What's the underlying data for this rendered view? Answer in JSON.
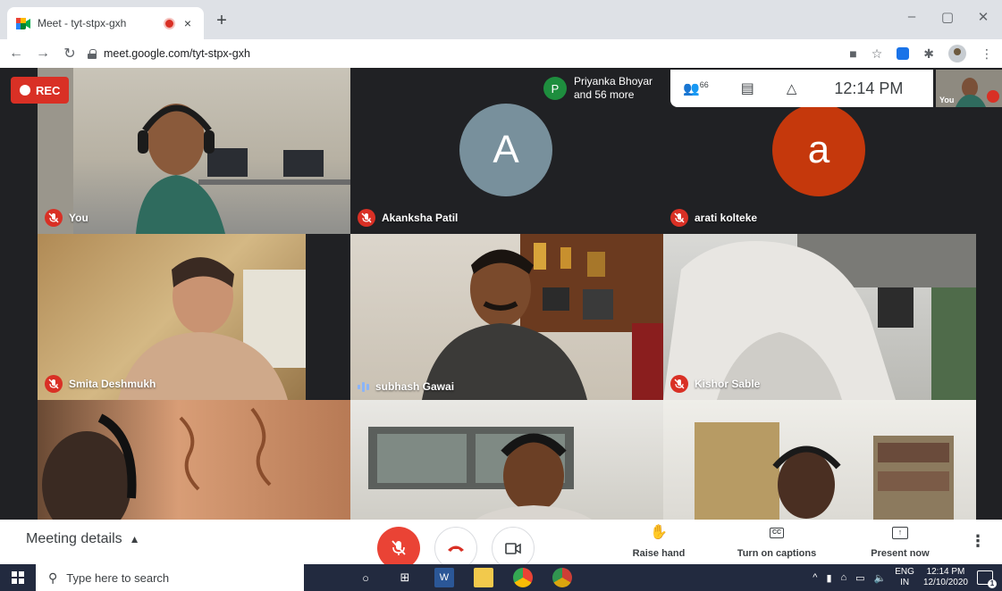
{
  "browser": {
    "tab_title": "Meet - tyt-stpx-gxh",
    "tab_close": "×",
    "new_tab": "+",
    "url": "meet.google.com/tyt-stpx-gxh",
    "win_minimize": "–",
    "win_restore": "▢",
    "win_close": "✕"
  },
  "meet": {
    "rec_label": "REC",
    "presenter_initial": "P",
    "presenter_name": "Priyanka Bhoyar",
    "presenter_more": "and 56 more",
    "people_count": "66",
    "clock": "12:14 PM",
    "self_mini_label": "You",
    "tiles": [
      {
        "name": "You",
        "status": "muted"
      },
      {
        "name": "Akanksha Patil",
        "status": "muted",
        "initial": "A"
      },
      {
        "name": "arati kolteke",
        "status": "muted",
        "initial": "a"
      },
      {
        "name": "Smita Deshmukh",
        "status": "muted"
      },
      {
        "name": "subhash Gawai",
        "status": "speaking"
      },
      {
        "name": "Kishor Sable",
        "status": "muted"
      }
    ],
    "colors": {
      "mute_red": "#d93025",
      "avatar_grey": "#78909c",
      "avatar_orange": "#c5380c",
      "presenter_green": "#1e8e3e"
    }
  },
  "meetbar": {
    "meeting_details": "Meeting details",
    "raise_hand": "Raise hand",
    "captions": "Turn on captions",
    "present": "Present now"
  },
  "taskbar": {
    "search_placeholder": "Type here to search",
    "lang_top": "ENG",
    "lang_bottom": "IN",
    "time": "12:14 PM",
    "date": "12/10/2020",
    "notif_count": "1"
  }
}
